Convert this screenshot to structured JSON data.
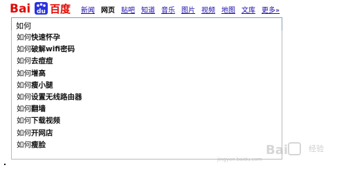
{
  "logo": {
    "text_bai": "Bai",
    "text_du": "du",
    "text_cn": "百度"
  },
  "nav": {
    "items": [
      {
        "label": "新闻",
        "active": false
      },
      {
        "label": "网页",
        "active": true
      },
      {
        "label": "贴吧",
        "active": false
      },
      {
        "label": "知道",
        "active": false
      },
      {
        "label": "音乐",
        "active": false
      },
      {
        "label": "图片",
        "active": false
      },
      {
        "label": "视频",
        "active": false
      },
      {
        "label": "地图",
        "active": false
      },
      {
        "label": "文库",
        "active": false
      },
      {
        "label": "更多»",
        "active": false
      }
    ]
  },
  "search": {
    "value": "如何"
  },
  "suggestions": [
    {
      "prefix": "如何",
      "rest": "快速怀孕"
    },
    {
      "prefix": "如何",
      "rest": "破解wifi密码"
    },
    {
      "prefix": "如何",
      "rest": "去痘痘"
    },
    {
      "prefix": "如何",
      "rest": "增高"
    },
    {
      "prefix": "如何",
      "rest": "瘦小腿"
    },
    {
      "prefix": "如何",
      "rest": "设置无线路由器"
    },
    {
      "prefix": "如何",
      "rest": "翻墙"
    },
    {
      "prefix": "如何",
      "rest": "下载视频"
    },
    {
      "prefix": "如何",
      "rest": "开网店"
    },
    {
      "prefix": "如何",
      "rest": "瘦脸"
    }
  ],
  "watermark": {
    "url": "jingyan.baidu.com",
    "label": "经验"
  },
  "colors": {
    "brand_red": "#e10601",
    "brand_blue": "#2932e1",
    "link": "#1a0dab"
  }
}
